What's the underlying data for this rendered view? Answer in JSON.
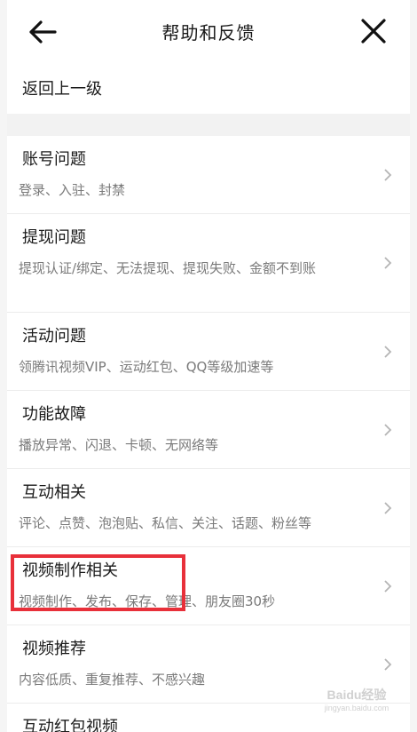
{
  "header": {
    "title": "帮助和反馈",
    "back_icon": "arrow-left-icon",
    "close_icon": "close-icon"
  },
  "back_row": {
    "label": "返回上一级"
  },
  "items": [
    {
      "name": "账号问题",
      "desc": "登录、入驻、封禁"
    },
    {
      "name": "提现问题",
      "desc": "提现认证/绑定、无法提现、提现失败、金额不到账"
    },
    {
      "name": "活动问题",
      "desc": "领腾讯视频VIP、运动红包、QQ等级加速等"
    },
    {
      "name": "功能故障",
      "desc": "播放异常、闪退、卡顿、无网络等"
    },
    {
      "name": "互动相关",
      "desc": "评论、点赞、泡泡贴、私信、关注、话题、粉丝等"
    },
    {
      "name": "视频制作相关",
      "desc": "视频制作、发布、保存、管理、朋友圈30秒"
    },
    {
      "name": "视频推荐",
      "desc": "内容低质、重复推荐、不感兴趣"
    },
    {
      "name": "互动红包视频",
      "desc": ""
    }
  ],
  "watermark": {
    "logo": "Baidu经验",
    "url": "jingyan.baidu.com"
  },
  "colors": {
    "highlight": "#e8303a",
    "background": "#f5f5f5",
    "divider": "#ececec"
  }
}
